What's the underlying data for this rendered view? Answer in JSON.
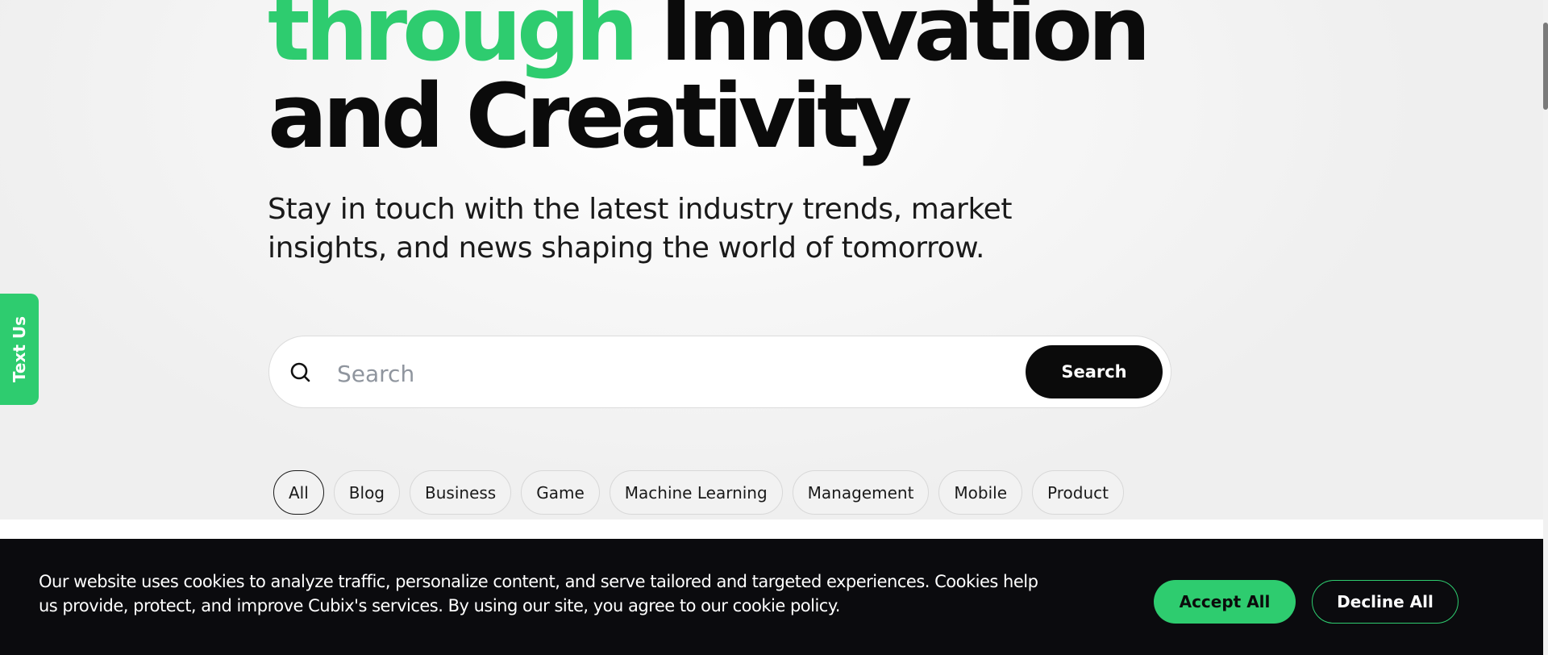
{
  "hero": {
    "headline_green": "through",
    "headline_line1_rest": "Innovation",
    "headline_line2": "and Creativity",
    "subtitle": "Stay in touch with the latest industry trends, market insights, and news shaping the world of tomorrow."
  },
  "search": {
    "icon": "search-icon",
    "placeholder": "Search",
    "value": "",
    "button_label": "Search"
  },
  "filters": [
    {
      "label": "All",
      "active": true
    },
    {
      "label": "Blog",
      "active": false
    },
    {
      "label": "Business",
      "active": false
    },
    {
      "label": "Game",
      "active": false
    },
    {
      "label": "Machine Learning",
      "active": false
    },
    {
      "label": "Management",
      "active": false
    },
    {
      "label": "Mobile",
      "active": false
    },
    {
      "label": "Product",
      "active": false
    }
  ],
  "side_tab": {
    "label": "Text Us"
  },
  "cookie_banner": {
    "text": "Our website uses cookies to analyze traffic, personalize content, and serve tailored and targeted experiences. Cookies help us provide, protect, and improve Cubix's services. By using our site, you agree to our cookie policy.",
    "accept_label": "Accept All",
    "decline_label": "Decline All"
  },
  "colors": {
    "accent": "#2ecc6f",
    "dark": "#0b0b0b",
    "background": "#f2f2f2"
  }
}
